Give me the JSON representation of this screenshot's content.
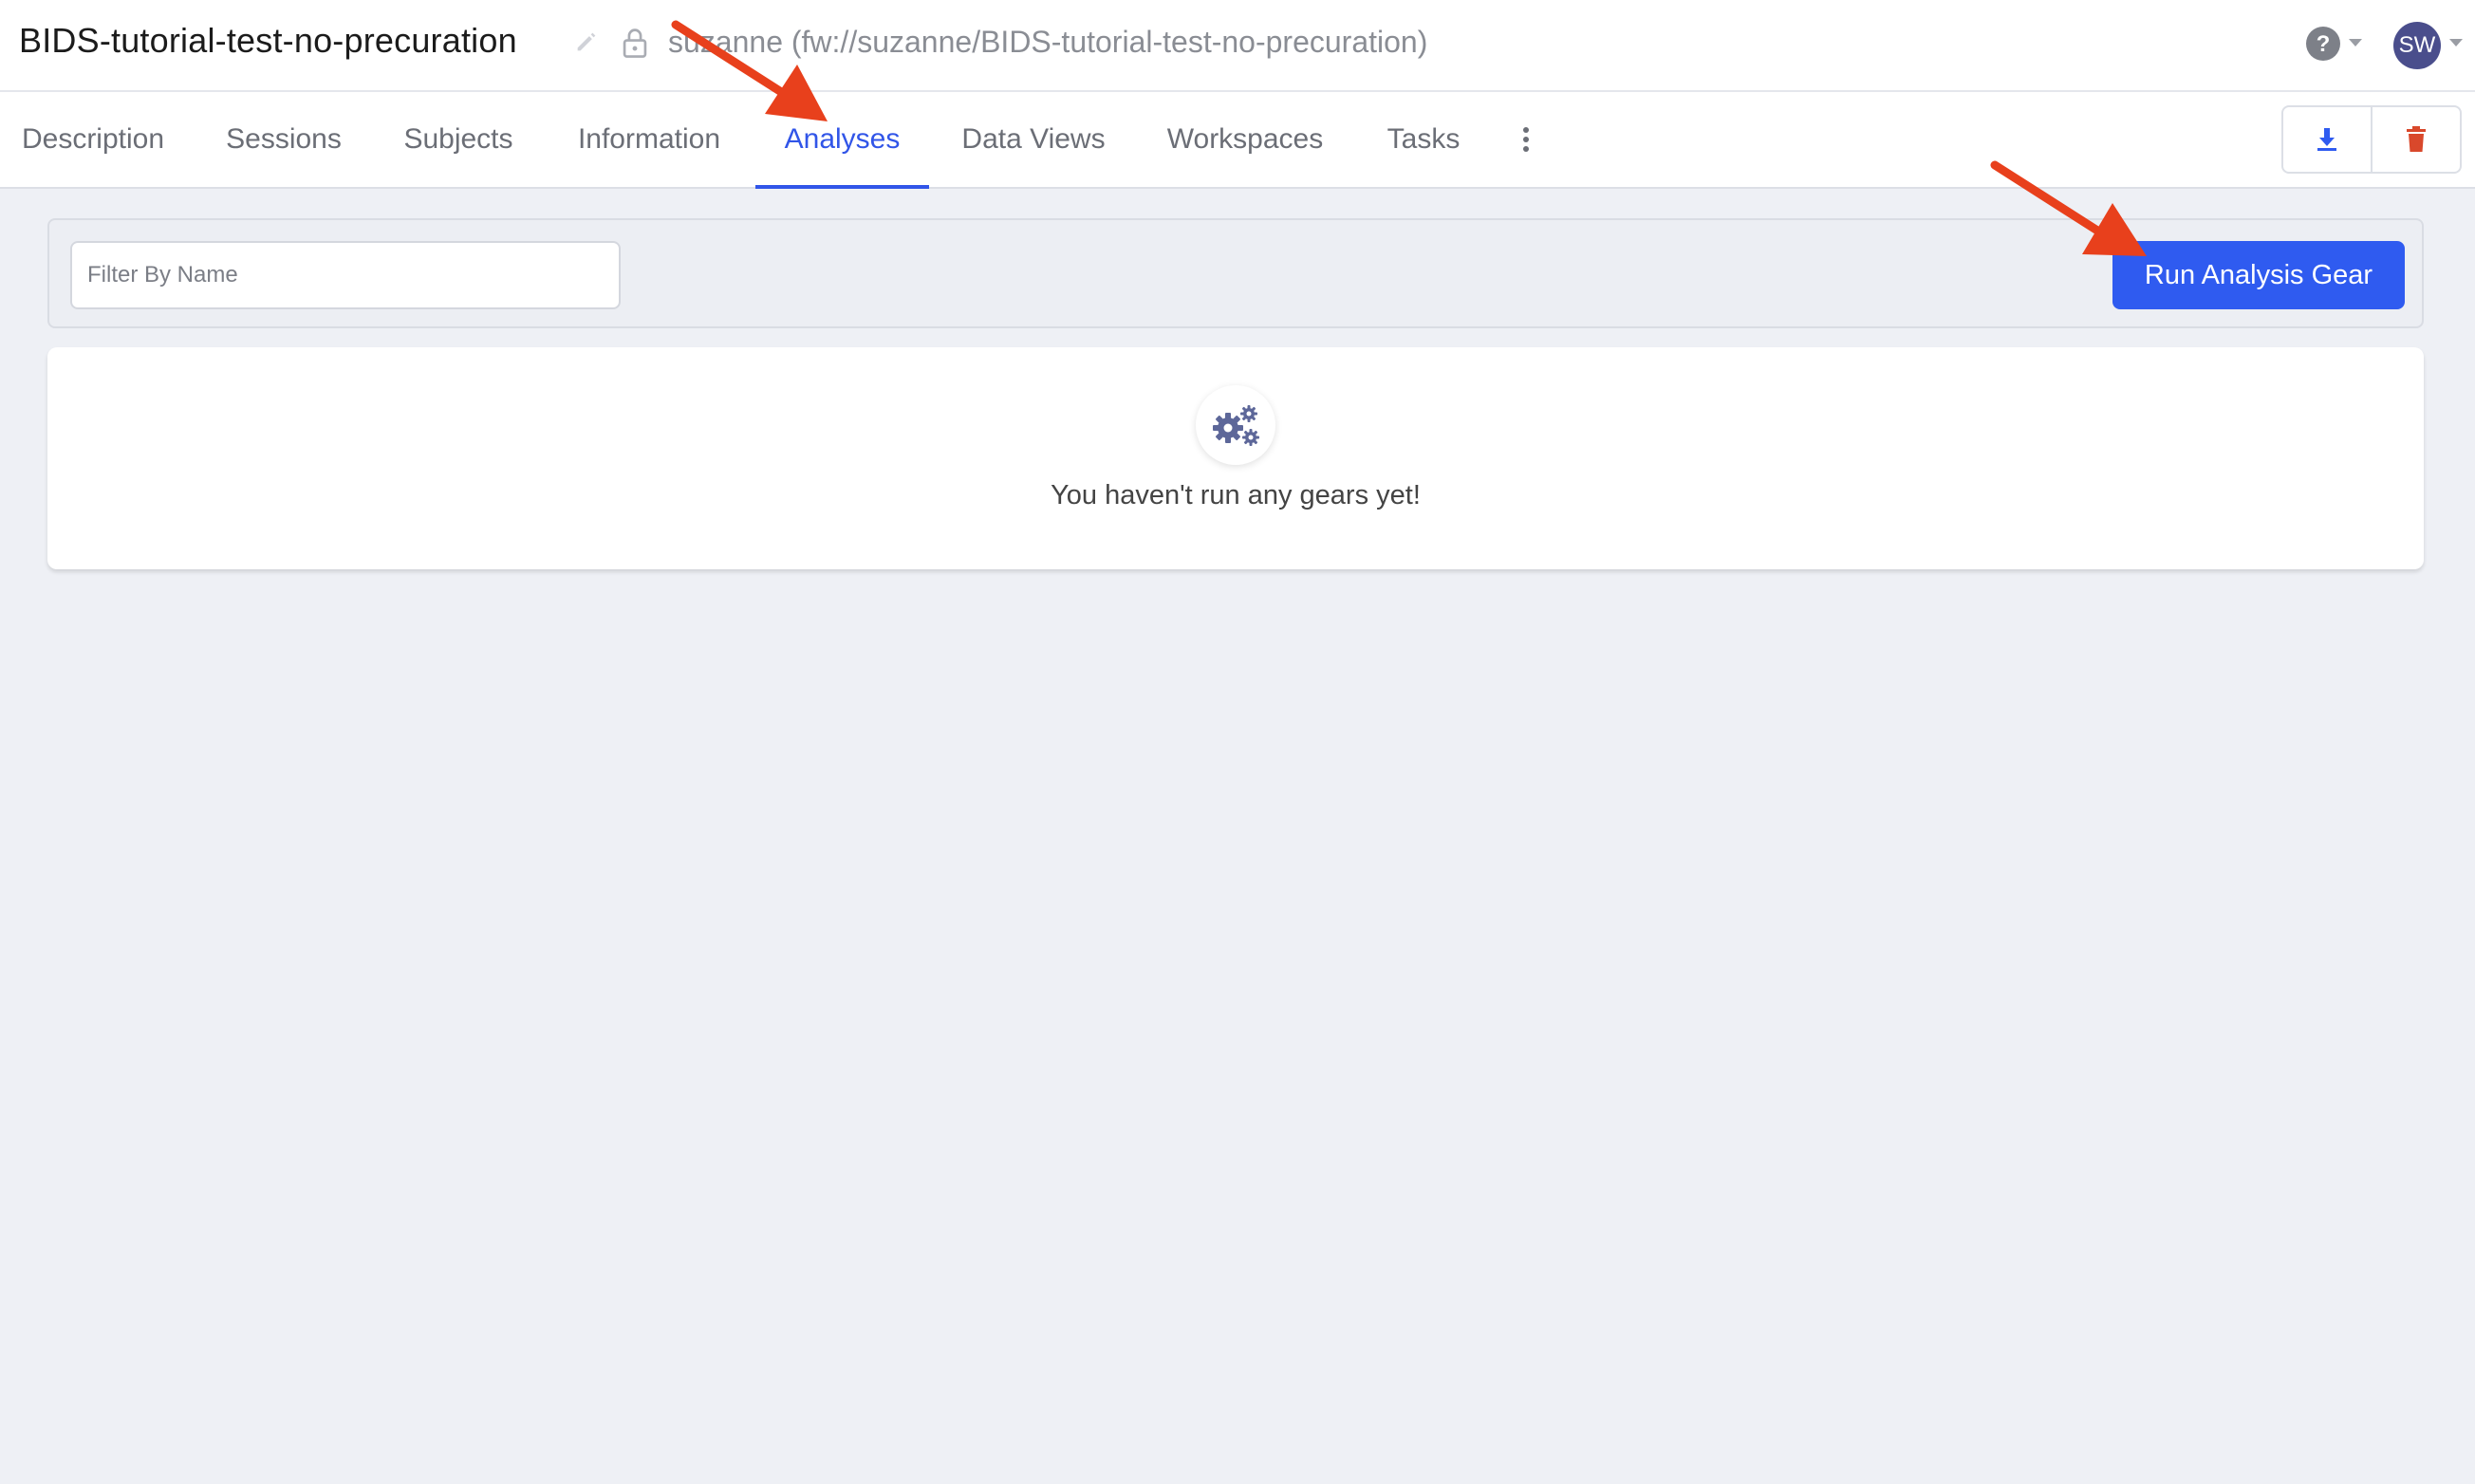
{
  "header": {
    "project_title": "BIDS-tutorial-test-no-precuration",
    "project_path": "suzanne (fw://suzanne/BIDS-tutorial-test-no-precuration)",
    "avatar_initials": "SW"
  },
  "tabs": [
    {
      "label": "Description"
    },
    {
      "label": "Sessions"
    },
    {
      "label": "Subjects"
    },
    {
      "label": "Information"
    },
    {
      "label": "Analyses",
      "active": true
    },
    {
      "label": "Data Views"
    },
    {
      "label": "Workspaces"
    },
    {
      "label": "Tasks"
    }
  ],
  "toolbar": {
    "filter_placeholder": "Filter By Name",
    "run_button_label": "Run Analysis Gear"
  },
  "empty_state": {
    "message": "You haven't run any gears yet!"
  },
  "colors": {
    "accent": "#3155e8",
    "primary_button": "#2f5bf0",
    "download_icon": "#2f5bf0",
    "delete_icon": "#d9482b",
    "annotation_arrow": "#e8401c",
    "avatar_bg": "#4a4e8c"
  },
  "icons": [
    "pencil-icon",
    "lock-icon",
    "help-circle-icon",
    "caret-down-icon",
    "kebab-more-icon",
    "download-icon",
    "trash-icon",
    "gears-icon"
  ]
}
